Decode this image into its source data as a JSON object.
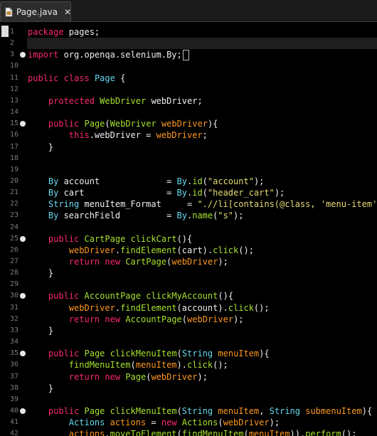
{
  "tab": {
    "title": "Page.java",
    "close": "✕",
    "icon": "java-file-icon"
  },
  "colors": {
    "background": "#000000",
    "keyword_pink": "#f92672",
    "keyword_cyan": "#66d9ef",
    "method_green": "#a6e22e",
    "string_yellow": "#e6db74",
    "param_orange": "#fd971f",
    "text": "#e8e8e8"
  },
  "editor": {
    "lines": [
      {
        "num": "1",
        "marker": false,
        "cursor": true,
        "tokens": [
          [
            "pink",
            "package"
          ],
          [
            "white",
            " pages;"
          ]
        ]
      },
      {
        "num": "2",
        "marker": false,
        "tokens": []
      },
      {
        "num": "3",
        "marker": true,
        "tokens": [
          [
            "pink",
            "import"
          ],
          [
            "white",
            " org.openqa.selenium.By;"
          ]
        ],
        "caret": true
      },
      {
        "num": "10",
        "marker": false,
        "tokens": []
      },
      {
        "num": "11",
        "marker": false,
        "tokens": [
          [
            "pink",
            "public"
          ],
          [
            "white",
            " "
          ],
          [
            "pink",
            "class"
          ],
          [
            "white",
            " "
          ],
          [
            "cyan",
            "Page"
          ],
          [
            "white",
            " {"
          ]
        ]
      },
      {
        "num": "12",
        "marker": false,
        "tokens": []
      },
      {
        "num": "13",
        "marker": false,
        "tokens": [
          [
            "white",
            "    "
          ],
          [
            "pink",
            "protected"
          ],
          [
            "white",
            " "
          ],
          [
            "green",
            "WebDriver"
          ],
          [
            "white",
            " "
          ],
          [
            "white",
            "webDriver;"
          ]
        ]
      },
      {
        "num": "14",
        "marker": false,
        "tokens": []
      },
      {
        "num": "15",
        "marker": true,
        "tokens": [
          [
            "white",
            "    "
          ],
          [
            "pink",
            "public"
          ],
          [
            "white",
            " "
          ],
          [
            "green",
            "Page"
          ],
          [
            "white",
            "("
          ],
          [
            "green",
            "WebDriver"
          ],
          [
            "white",
            " "
          ],
          [
            "orange",
            "webDriver"
          ],
          [
            "white",
            "){"
          ]
        ]
      },
      {
        "num": "16",
        "marker": false,
        "tokens": [
          [
            "white",
            "        "
          ],
          [
            "pink",
            "this"
          ],
          [
            "white",
            ".webDriver = "
          ],
          [
            "orange",
            "webDriver"
          ],
          [
            "white",
            ";"
          ]
        ]
      },
      {
        "num": "17",
        "marker": false,
        "tokens": [
          [
            "white",
            "    }"
          ]
        ]
      },
      {
        "num": "18",
        "marker": false,
        "tokens": []
      },
      {
        "num": "19",
        "marker": false,
        "tokens": []
      },
      {
        "num": "20",
        "marker": false,
        "tokens": [
          [
            "white",
            "    "
          ],
          [
            "cyan",
            "By"
          ],
          [
            "white",
            " account             = "
          ],
          [
            "cyan",
            "By"
          ],
          [
            "white",
            "."
          ],
          [
            "green",
            "id"
          ],
          [
            "white",
            "("
          ],
          [
            "yellow",
            "\"account\""
          ],
          [
            "white",
            ");"
          ]
        ]
      },
      {
        "num": "21",
        "marker": false,
        "tokens": [
          [
            "white",
            "    "
          ],
          [
            "cyan",
            "By"
          ],
          [
            "white",
            " cart                = "
          ],
          [
            "cyan",
            "By"
          ],
          [
            "white",
            "."
          ],
          [
            "green",
            "id"
          ],
          [
            "white",
            "("
          ],
          [
            "yellow",
            "\"header_cart\""
          ],
          [
            "white",
            ");"
          ]
        ]
      },
      {
        "num": "22",
        "marker": false,
        "tokens": [
          [
            "white",
            "    "
          ],
          [
            "cyan",
            "String"
          ],
          [
            "white",
            " menuItem_Format     = "
          ],
          [
            "yellow",
            "\".//li[contains(@class, 'menu-item') and"
          ]
        ]
      },
      {
        "num": "23",
        "marker": false,
        "tokens": [
          [
            "white",
            "    "
          ],
          [
            "cyan",
            "By"
          ],
          [
            "white",
            " searchField         = "
          ],
          [
            "cyan",
            "By"
          ],
          [
            "white",
            "."
          ],
          [
            "green",
            "name"
          ],
          [
            "white",
            "("
          ],
          [
            "yellow",
            "\"s\""
          ],
          [
            "white",
            ");"
          ]
        ]
      },
      {
        "num": "24",
        "marker": false,
        "tokens": []
      },
      {
        "num": "25",
        "marker": true,
        "tokens": [
          [
            "white",
            "    "
          ],
          [
            "pink",
            "public"
          ],
          [
            "white",
            " "
          ],
          [
            "green",
            "CartPage"
          ],
          [
            "white",
            " "
          ],
          [
            "green",
            "clickCart"
          ],
          [
            "white",
            "(){"
          ]
        ]
      },
      {
        "num": "26",
        "marker": false,
        "tokens": [
          [
            "white",
            "        "
          ],
          [
            "orange",
            "webDriver"
          ],
          [
            "white",
            "."
          ],
          [
            "green",
            "findElement"
          ],
          [
            "white",
            "(cart)."
          ],
          [
            "green",
            "click"
          ],
          [
            "white",
            "();"
          ]
        ]
      },
      {
        "num": "27",
        "marker": false,
        "tokens": [
          [
            "white",
            "        "
          ],
          [
            "pink",
            "return"
          ],
          [
            "white",
            " "
          ],
          [
            "pink",
            "new"
          ],
          [
            "white",
            " "
          ],
          [
            "green",
            "CartPage"
          ],
          [
            "white",
            "("
          ],
          [
            "orange",
            "webDriver"
          ],
          [
            "white",
            ");"
          ]
        ]
      },
      {
        "num": "28",
        "marker": false,
        "tokens": [
          [
            "white",
            "    }"
          ]
        ]
      },
      {
        "num": "29",
        "marker": false,
        "tokens": []
      },
      {
        "num": "30",
        "marker": true,
        "tokens": [
          [
            "white",
            "    "
          ],
          [
            "pink",
            "public"
          ],
          [
            "white",
            " "
          ],
          [
            "green",
            "AccountPage"
          ],
          [
            "white",
            " "
          ],
          [
            "green",
            "clickMyAccount"
          ],
          [
            "white",
            "(){"
          ]
        ]
      },
      {
        "num": "31",
        "marker": false,
        "tokens": [
          [
            "white",
            "        "
          ],
          [
            "orange",
            "webDriver"
          ],
          [
            "white",
            "."
          ],
          [
            "green",
            "findElement"
          ],
          [
            "white",
            "(account)."
          ],
          [
            "green",
            "click"
          ],
          [
            "white",
            "();"
          ]
        ]
      },
      {
        "num": "32",
        "marker": false,
        "tokens": [
          [
            "white",
            "        "
          ],
          [
            "pink",
            "return"
          ],
          [
            "white",
            " "
          ],
          [
            "pink",
            "new"
          ],
          [
            "white",
            " "
          ],
          [
            "green",
            "AccountPage"
          ],
          [
            "white",
            "("
          ],
          [
            "orange",
            "webDriver"
          ],
          [
            "white",
            ");"
          ]
        ]
      },
      {
        "num": "33",
        "marker": false,
        "tokens": [
          [
            "white",
            "    }"
          ]
        ]
      },
      {
        "num": "34",
        "marker": false,
        "tokens": []
      },
      {
        "num": "35",
        "marker": true,
        "tokens": [
          [
            "white",
            "    "
          ],
          [
            "pink",
            "public"
          ],
          [
            "white",
            " "
          ],
          [
            "green",
            "Page"
          ],
          [
            "white",
            " "
          ],
          [
            "green",
            "clickMenuItem"
          ],
          [
            "white",
            "("
          ],
          [
            "cyan",
            "String"
          ],
          [
            "white",
            " "
          ],
          [
            "orange",
            "menuItem"
          ],
          [
            "white",
            "){"
          ]
        ]
      },
      {
        "num": "36",
        "marker": false,
        "tokens": [
          [
            "white",
            "        "
          ],
          [
            "green",
            "findMenuItem"
          ],
          [
            "white",
            "("
          ],
          [
            "orange",
            "menuItem"
          ],
          [
            "white",
            ")."
          ],
          [
            "green",
            "click"
          ],
          [
            "white",
            "();"
          ]
        ]
      },
      {
        "num": "37",
        "marker": false,
        "tokens": [
          [
            "white",
            "        "
          ],
          [
            "pink",
            "return"
          ],
          [
            "white",
            " "
          ],
          [
            "pink",
            "new"
          ],
          [
            "white",
            " "
          ],
          [
            "green",
            "Page"
          ],
          [
            "white",
            "("
          ],
          [
            "orange",
            "webDriver"
          ],
          [
            "white",
            ");"
          ]
        ]
      },
      {
        "num": "38",
        "marker": false,
        "tokens": [
          [
            "white",
            "    }"
          ]
        ]
      },
      {
        "num": "39",
        "marker": false,
        "tokens": []
      },
      {
        "num": "40",
        "marker": true,
        "tokens": [
          [
            "white",
            "    "
          ],
          [
            "pink",
            "public"
          ],
          [
            "white",
            " "
          ],
          [
            "green",
            "Page"
          ],
          [
            "white",
            " "
          ],
          [
            "green",
            "clickMenuItem"
          ],
          [
            "white",
            "("
          ],
          [
            "cyan",
            "String"
          ],
          [
            "white",
            " "
          ],
          [
            "orange",
            "menuItem"
          ],
          [
            "white",
            ", "
          ],
          [
            "cyan",
            "String"
          ],
          [
            "white",
            " "
          ],
          [
            "orange",
            "submenuItem"
          ],
          [
            "white",
            "){"
          ]
        ]
      },
      {
        "num": "41",
        "marker": false,
        "tokens": [
          [
            "white",
            "        "
          ],
          [
            "cyan",
            "Actions"
          ],
          [
            "white",
            " "
          ],
          [
            "orange",
            "actions"
          ],
          [
            "white",
            " = "
          ],
          [
            "pink",
            "new"
          ],
          [
            "white",
            " "
          ],
          [
            "green",
            "Actions"
          ],
          [
            "white",
            "("
          ],
          [
            "orange",
            "webDriver"
          ],
          [
            "white",
            ");"
          ]
        ]
      },
      {
        "num": "42",
        "marker": false,
        "tokens": [
          [
            "white",
            "        "
          ],
          [
            "orange",
            "actions"
          ],
          [
            "white",
            "."
          ],
          [
            "green",
            "moveToElement"
          ],
          [
            "white",
            "("
          ],
          [
            "green",
            "findMenuItem"
          ],
          [
            "white",
            "("
          ],
          [
            "orange",
            "menuItem"
          ],
          [
            "white",
            "))."
          ],
          [
            "green",
            "perform"
          ],
          [
            "white",
            "();"
          ]
        ]
      }
    ]
  }
}
